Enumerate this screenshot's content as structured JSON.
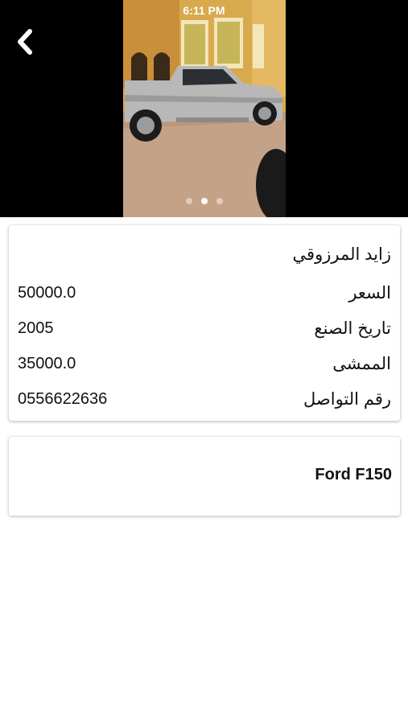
{
  "status_bar": {
    "time": "6:11 PM"
  },
  "header": {
    "back_icon": "chevron-left-icon",
    "gallery": {
      "image_count": 3,
      "active_index": 1
    }
  },
  "details": {
    "owner_name": "زايد المرزوقي",
    "rows": [
      {
        "label": "السعر",
        "value": "50000.0"
      },
      {
        "label": "تاريخ الصنع",
        "value": "2005"
      },
      {
        "label": "الممشى",
        "value": "35000.0"
      },
      {
        "label": "رقم التواصل",
        "value": "0556622636"
      }
    ]
  },
  "model": {
    "name": "Ford F150"
  },
  "colors": {
    "background": "#ffffff",
    "gallery_bg": "#000000",
    "text": "#111111"
  }
}
